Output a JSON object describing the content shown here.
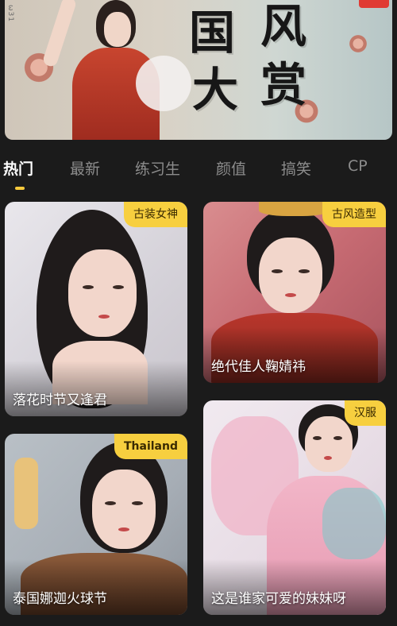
{
  "banner": {
    "side_text": "ω31",
    "calligraphy": [
      "国",
      "风",
      "大",
      "赏"
    ]
  },
  "tabs": [
    {
      "label": "热门",
      "active": true
    },
    {
      "label": "最新",
      "active": false
    },
    {
      "label": "练习生",
      "active": false
    },
    {
      "label": "颜值",
      "active": false
    },
    {
      "label": "搞笑",
      "active": false
    },
    {
      "label": "CP",
      "active": false
    }
  ],
  "cards": [
    {
      "badge": "古装女神",
      "title": "落花时节又逢君"
    },
    {
      "badge": "古风造型",
      "title": "绝代佳人鞠婧祎"
    },
    {
      "badge": "Thailand",
      "title": "泰国娜迦火球节"
    },
    {
      "badge": "汉服",
      "title": "这是谁家可爱的妹妹呀"
    }
  ],
  "colors": {
    "background": "#1b1b1b",
    "accent": "#f7cf3f",
    "tab_inactive": "#8c8c8c",
    "tab_active": "#ffffff"
  }
}
